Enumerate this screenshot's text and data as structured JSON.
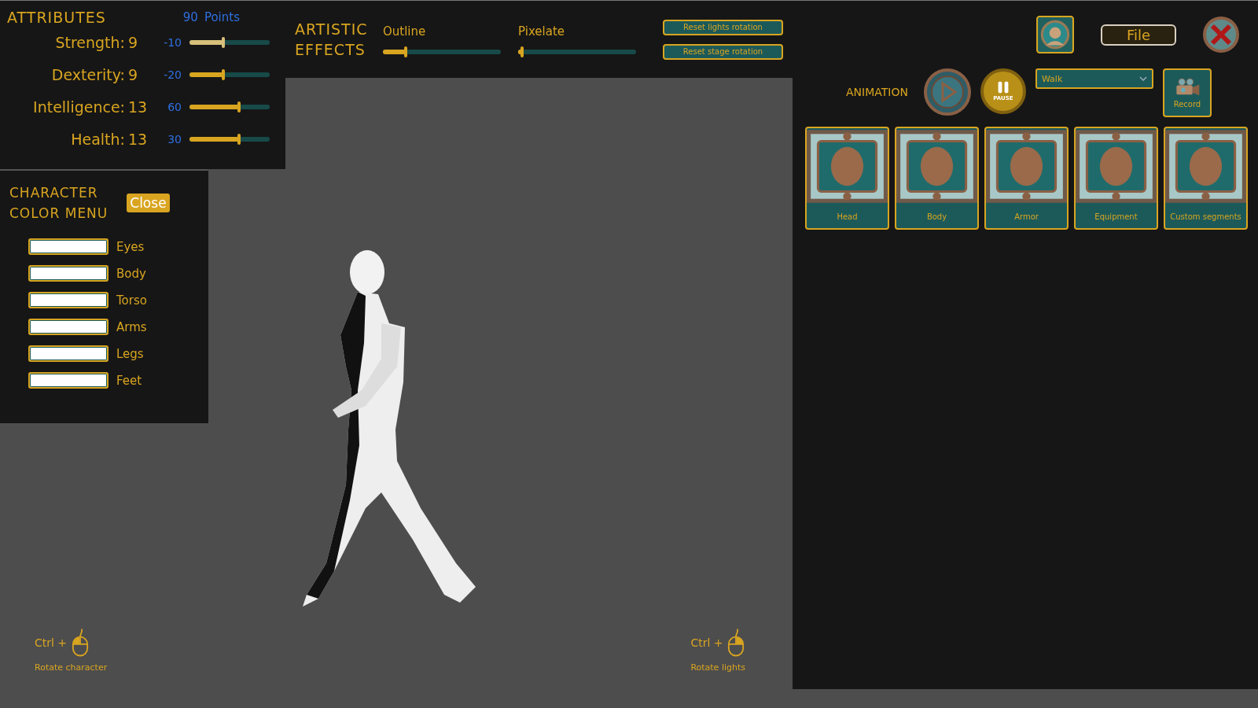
{
  "attributes": {
    "title": "ATTRIBUTES",
    "points": "90",
    "points_label": "Points",
    "stats": [
      {
        "label": "Strength:",
        "value": "9",
        "modifier": "-10",
        "level": 0.42,
        "highlighted": true
      },
      {
        "label": "Dexterity:",
        "value": "9",
        "modifier": "-20",
        "level": 0.42,
        "highlighted": false
      },
      {
        "label": "Intelligence:",
        "value": "13",
        "modifier": "60",
        "level": 0.62,
        "highlighted": false
      },
      {
        "label": "Health:",
        "value": "13",
        "modifier": "30",
        "level": 0.62,
        "highlighted": false
      }
    ]
  },
  "effects": {
    "title_lines": [
      "ARTISTIC",
      "EFFECTS"
    ],
    "sliders": [
      {
        "label": "Outline",
        "level": 0.19
      },
      {
        "label": "Pixelate",
        "level": 0.03
      }
    ],
    "buttons": [
      "Reset lights rotation",
      "Reset stage rotation"
    ]
  },
  "color_menu": {
    "title_lines": [
      "CHARACTER",
      "COLOR MENU"
    ],
    "close": "Close",
    "items": [
      {
        "label": "Eyes",
        "color": "#ffffff"
      },
      {
        "label": "Body",
        "color": "#ffffff"
      },
      {
        "label": "Torso",
        "color": "#ffffff"
      },
      {
        "label": "Arms",
        "color": "#ffffff"
      },
      {
        "label": "Legs",
        "color": "#ffffff"
      },
      {
        "label": "Feet",
        "color": "#ffffff"
      }
    ]
  },
  "hints": [
    {
      "keys": "Ctrl +",
      "label": "Rotate character"
    },
    {
      "keys": "Ctrl +",
      "label": "Rotate lights"
    }
  ],
  "top_right": {
    "file": "File"
  },
  "animation": {
    "label": "ANIMATION",
    "pause_text": "PAUSE",
    "selected": "Walk",
    "record": "Record"
  },
  "categories": [
    {
      "label": "Head"
    },
    {
      "label": "Body"
    },
    {
      "label": "Armor"
    },
    {
      "label": "Equipment"
    },
    {
      "label": "Custom segments"
    }
  ]
}
